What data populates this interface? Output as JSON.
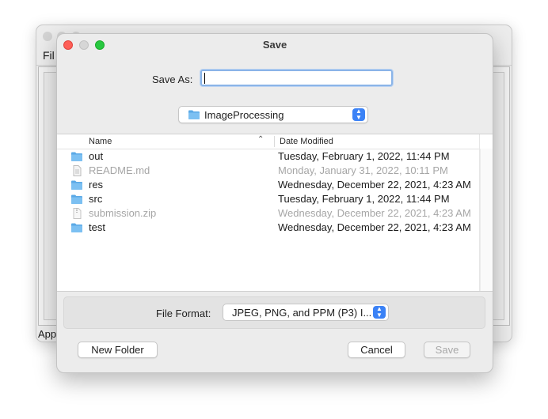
{
  "background_window": {
    "menu_partial": "Fil",
    "status_partial": "App"
  },
  "dialog": {
    "title": "Save",
    "save_as": {
      "label": "Save As:",
      "value": ""
    },
    "location": {
      "selected": "ImageProcessing",
      "icon": "folder-icon"
    },
    "browser": {
      "columns": {
        "name": "Name",
        "date": "Date Modified",
        "sort_indicator": "⌃"
      },
      "rows": [
        {
          "name": "out",
          "date": "Tuesday, February 1, 2022, 11:44 PM",
          "icon": "folder-icon",
          "enabled": true
        },
        {
          "name": "README.md",
          "date": "Monday, January 31, 2022, 10:11 PM",
          "icon": "document-icon",
          "enabled": false
        },
        {
          "name": "res",
          "date": "Wednesday, December 22, 2021, 4:23 AM",
          "icon": "folder-icon",
          "enabled": true
        },
        {
          "name": "src",
          "date": "Tuesday, February 1, 2022, 11:44 PM",
          "icon": "folder-icon",
          "enabled": true
        },
        {
          "name": "submission.zip",
          "date": "Wednesday, December 22, 2021, 4:23 AM",
          "icon": "zip-icon",
          "enabled": false
        },
        {
          "name": "test",
          "date": "Wednesday, December 22, 2021, 4:23 AM",
          "icon": "folder-icon",
          "enabled": true
        }
      ]
    },
    "file_format": {
      "label": "File Format:",
      "selected": "JPEG, PNG, and PPM (P3) I..."
    },
    "buttons": {
      "new_folder": "New Folder",
      "cancel": "Cancel",
      "save": "Save"
    }
  },
  "colors": {
    "accent": "#3b82f6",
    "folder": "#5aa9e6",
    "close": "#fe5f57",
    "zoom": "#28c840"
  }
}
